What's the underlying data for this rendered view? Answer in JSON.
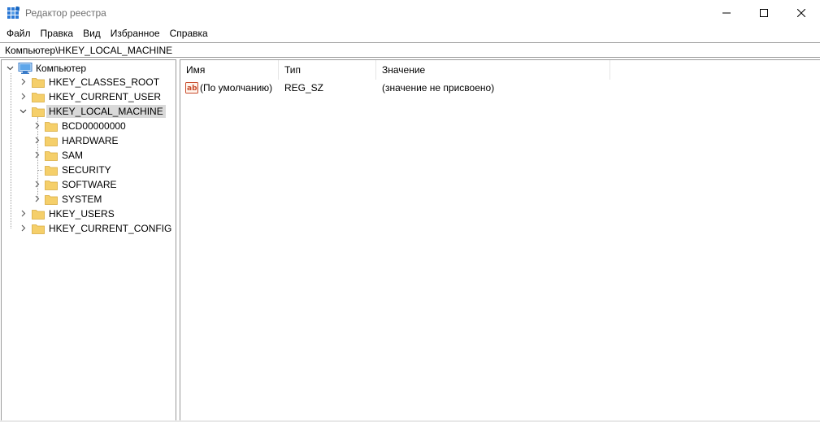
{
  "window": {
    "title": "Редактор реестра"
  },
  "menu": {
    "items": [
      "Файл",
      "Правка",
      "Вид",
      "Избранное",
      "Справка"
    ]
  },
  "address": {
    "path": "Компьютер\\HKEY_LOCAL_MACHINE"
  },
  "tree": {
    "root": "Компьютер",
    "hives": [
      "HKEY_CLASSES_ROOT",
      "HKEY_CURRENT_USER",
      "HKEY_LOCAL_MACHINE",
      "HKEY_USERS",
      "HKEY_CURRENT_CONFIG"
    ],
    "hklm_children": [
      "BCD00000000",
      "HARDWARE",
      "SAM",
      "SECURITY",
      "SOFTWARE",
      "SYSTEM"
    ],
    "selected": "HKEY_LOCAL_MACHINE"
  },
  "list": {
    "columns": [
      "Имя",
      "Тип",
      "Значение"
    ],
    "rows": [
      {
        "name": "(По умолчанию)",
        "type": "REG_SZ",
        "value": "(значение не присвоено)",
        "icon": "string-value-icon"
      }
    ]
  },
  "colors": {
    "folder": "#f5cf6a",
    "selection": "#d9d9d9",
    "accent": "#2b79d6"
  }
}
